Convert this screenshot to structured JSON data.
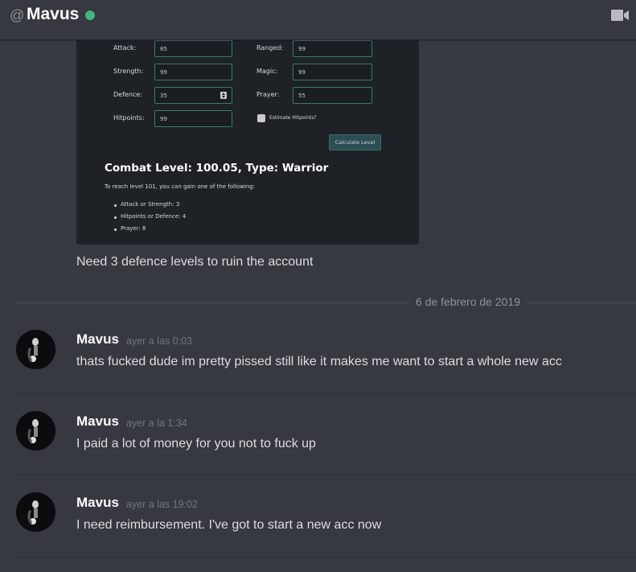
{
  "header": {
    "at_symbol": "@",
    "channel_name": "Mavus",
    "status_color": "#43b581",
    "call_icon": "video-camera-icon"
  },
  "embed": {
    "fields": {
      "attack": {
        "label": "Attack:",
        "value": "85"
      },
      "strength": {
        "label": "Strength:",
        "value": "99"
      },
      "defence": {
        "label": "Defence:",
        "value": "35"
      },
      "hitpoints": {
        "label": "Hitpoints:",
        "value": "99"
      },
      "ranged": {
        "label": "Ranged:",
        "value": "99"
      },
      "magic": {
        "label": "Magic:",
        "value": "99"
      },
      "prayer": {
        "label": "Prayer:",
        "value": "55"
      }
    },
    "estimate_hitpoints_label": "Estimate Hitpoints?",
    "calculate_button": "Calculate Level",
    "result": "Combat Level: 100.05, Type: Warrior",
    "reach_text": "To reach level 101, you can gain one of the following:",
    "options": [
      "Attack or Strength: 3",
      "Hitpoints or Defence: 4",
      "Prayer: 8"
    ]
  },
  "messages_top": {
    "continued_text": "Need 3 defence levels to ruin the account"
  },
  "date_divider": "6 de febrero de 2019",
  "messages": [
    {
      "author": "Mavus",
      "timestamp": "ayer a las 0:03",
      "text": "thats fucked dude im pretty pissed still like it makes me want to start a whole new acc"
    },
    {
      "author": "Mavus",
      "timestamp": "ayer a la 1:34",
      "text": "I paid a lot of money for you not to fuck up"
    },
    {
      "author": "Mavus",
      "timestamp": "ayer a las 19:02",
      "text": "I need reimbursement. I've got to start a new acc now"
    }
  ]
}
